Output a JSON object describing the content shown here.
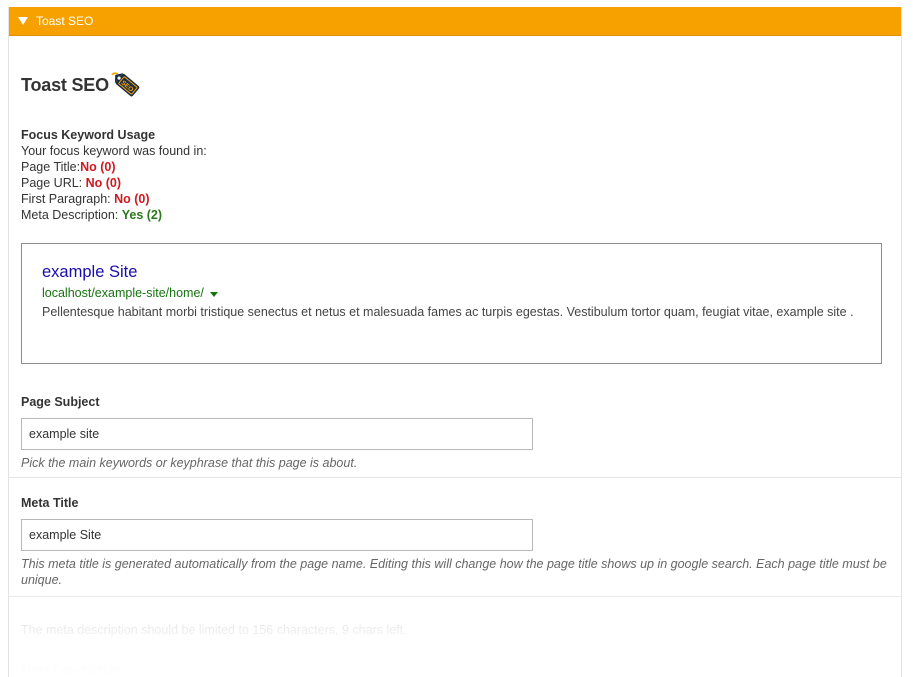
{
  "header": {
    "title": "Toast SEO"
  },
  "brand": {
    "title": "Toast SEO",
    "icon": "tag-icon",
    "icon_text": "SEO",
    "icon_colors": {
      "body": "#1b2d45",
      "accent": "#f7a100"
    }
  },
  "focus_keyword": {
    "title": "Focus Keyword Usage",
    "intro": "Your focus keyword was found in:",
    "rows": [
      {
        "label": "Page Title:",
        "value": "No (0)",
        "status": "no"
      },
      {
        "label": "Page URL: ",
        "value": "No (0)",
        "status": "no"
      },
      {
        "label": "First Paragraph: ",
        "value": "No (0)",
        "status": "no"
      },
      {
        "label": "Meta Description: ",
        "value": "Yes (2)",
        "status": "yes"
      }
    ]
  },
  "preview": {
    "title": "example Site",
    "url": "localhost/example-site/home/",
    "description": "Pellentesque habitant morbi tristique senectus et netus et malesuada fames ac turpis egestas. Vestibulum tortor quam, feugiat vitae, example site ."
  },
  "page_subject": {
    "label": "Page Subject",
    "value": "example site",
    "help": "Pick the main keywords or keyphrase that this page is about."
  },
  "meta_title": {
    "label": "Meta Title",
    "value": "example Site",
    "help": "This meta title is generated automatically from the page name. Editing this will change how the page title shows up in google search. Each page title must be unique."
  },
  "meta_description": {
    "note": "The meta description should be limited to 156 characters, 9 chars left.",
    "label": "Meta Description"
  },
  "colors": {
    "header": "#f7a100",
    "no": "#d0181f",
    "yes": "#2a7a1b",
    "link": "#1a0dab",
    "url": "#16730f"
  }
}
